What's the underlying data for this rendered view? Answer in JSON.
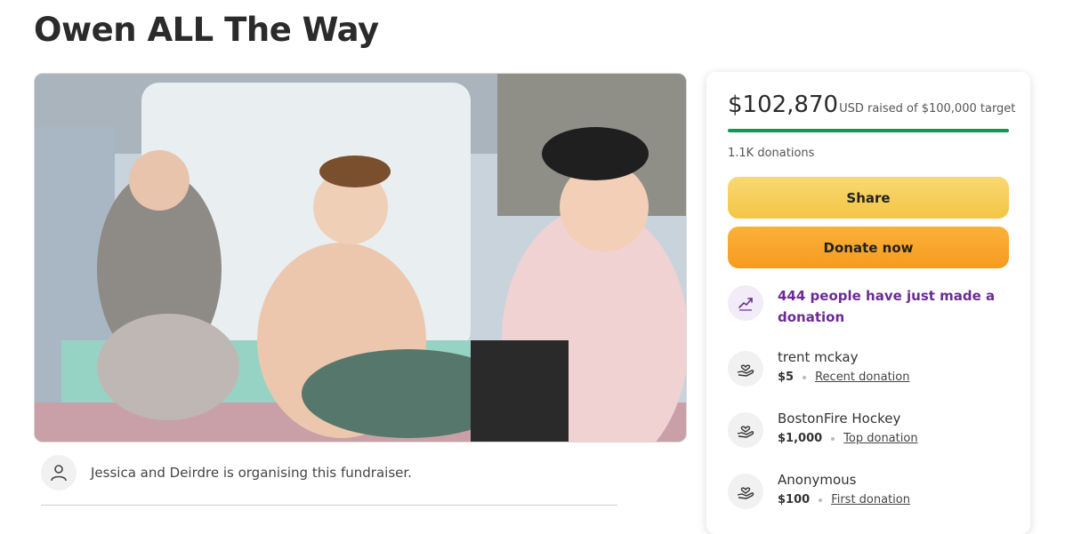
{
  "page": {
    "title": "Owen ALL The Way"
  },
  "organiser": {
    "text": "Jessica and Deirdre is organising this fundraiser."
  },
  "summary": {
    "amount": "$102,870",
    "meta": "USD raised of $100,000 target",
    "progress_fraction": 1.0,
    "donations": "1.1K donations"
  },
  "buttons": {
    "share": "Share",
    "donate": "Donate now"
  },
  "recent_activity": {
    "text": "444 people have just made a donation"
  },
  "donors": [
    {
      "name": "trent mckay",
      "amount": "$5",
      "tag": "Recent donation"
    },
    {
      "name": "BostonFire Hockey",
      "amount": "$1,000",
      "tag": "Top donation"
    },
    {
      "name": "Anonymous",
      "amount": "$100",
      "tag": "First donation"
    }
  ],
  "colors": {
    "progress": "#0a9c55",
    "share": "#f7cd5a",
    "donate": "#f69a1f",
    "accent_purple": "#6c2c94"
  },
  "icons": {
    "organiser": "user-icon",
    "trend": "trending-up-icon",
    "donor": "hand-heart-icon"
  }
}
